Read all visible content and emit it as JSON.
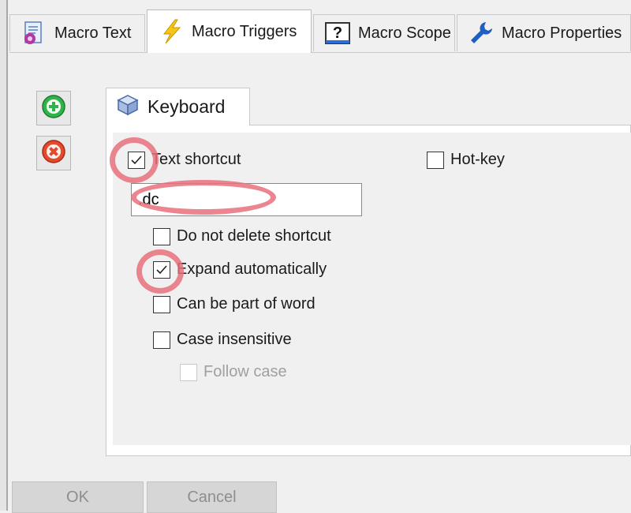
{
  "tabs": [
    {
      "label": "Macro Text",
      "icon": "macro-text-icon",
      "active": false
    },
    {
      "label": "Macro Triggers",
      "icon": "lightning-icon",
      "active": true
    },
    {
      "label": "Macro Scope",
      "icon": "question-mark-icon",
      "active": false
    },
    {
      "label": "Macro Properties",
      "icon": "wrench-icon",
      "active": false
    }
  ],
  "side_buttons": [
    {
      "icon": "add-green-icon"
    },
    {
      "icon": "delete-red-icon"
    }
  ],
  "trigger_tab": {
    "label": "Keyboard",
    "icon": "keyboard-cube-icon"
  },
  "options": {
    "text_shortcut": {
      "label": "Text shortcut",
      "checked": true
    },
    "hot_key": {
      "label": "Hot-key",
      "checked": false
    },
    "shortcut_value": ".dc",
    "do_not_delete": {
      "label": "Do not delete shortcut",
      "checked": false
    },
    "expand_auto": {
      "label": "Expand automatically",
      "checked": true
    },
    "part_of_word": {
      "label": "Can be part of word",
      "checked": false
    },
    "case_insensitive": {
      "label": "Case insensitive",
      "checked": false
    },
    "follow_case": {
      "label": "Follow case",
      "checked": false,
      "disabled": true
    }
  },
  "footer": {
    "ok": "OK",
    "cancel": "Cancel"
  },
  "colors": {
    "highlight_ring": "#e7707c",
    "add": "#2fb34a",
    "delete": "#e5492d"
  }
}
